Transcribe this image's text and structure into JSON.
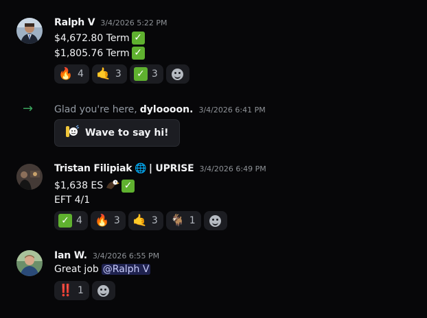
{
  "messages": [
    {
      "author": "Ralph V",
      "timestamp": "3/4/2026 5:22 PM",
      "lines": [
        {
          "text": "$4,672.80  Term"
        },
        {
          "text": "$1,805.76  Term"
        }
      ],
      "reactions": [
        {
          "emoji": "🔥",
          "count": "4"
        },
        {
          "emoji": "🤙",
          "count": "3"
        },
        {
          "emoji": "✓",
          "count": "3"
        }
      ]
    },
    {
      "join_text": "Glad you're here,",
      "join_user": "dyloooon.",
      "timestamp": "3/4/2026 6:41 PM",
      "wave_label": "Wave to say hi!"
    },
    {
      "author": "Tristan Filipiak",
      "author_suffix": "| UPRISE",
      "timestamp": "3/4/2026 6:49 PM",
      "lines": [
        {
          "text": "$1,638 ES"
        },
        {
          "text": "EFT 4/1"
        }
      ],
      "reactions": [
        {
          "emoji": "✓",
          "count": "4"
        },
        {
          "emoji": "🔥",
          "count": "3"
        },
        {
          "emoji": "🤙",
          "count": "3"
        },
        {
          "emoji": "🐐",
          "count": "1"
        }
      ]
    },
    {
      "author": "Ian W.",
      "timestamp": "3/4/2026 6:55 PM",
      "lines": [
        {
          "text": "Great job",
          "mention": "@Ralph V"
        }
      ],
      "reactions": [
        {
          "emoji": "‼️",
          "count": "1"
        }
      ]
    }
  ],
  "colors": {
    "background": "#070709",
    "reaction_bg": "#1c1d22",
    "check_green": "#5fb12f",
    "join_arrow": "#3ba55d",
    "mention_text": "#c9cdfb"
  },
  "icons": {
    "join_arrow": "arrow-right-icon",
    "add_reaction": "smiley-face-icon",
    "globe": "globe-icon",
    "eagle": "eagle-icon",
    "wave": "waving-character-icon"
  }
}
